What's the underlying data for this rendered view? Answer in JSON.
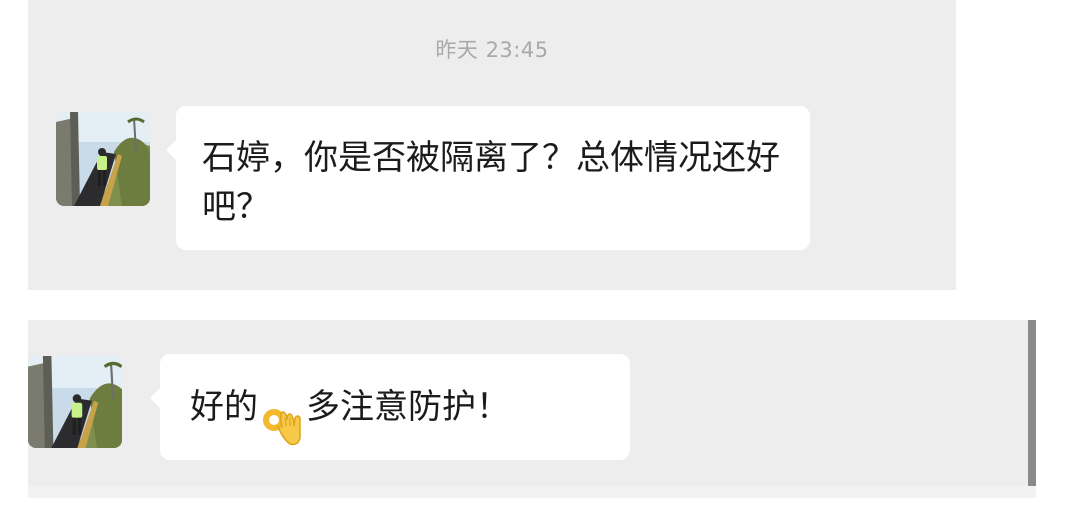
{
  "chat": {
    "timestamp": "昨天 23:45",
    "messages": [
      {
        "sender": "contact",
        "avatar_icon": "avatar-photo-icon",
        "text": "石婷，你是否被隔离了？总体情况还好吧？"
      },
      {
        "sender": "contact",
        "avatar_icon": "avatar-photo-icon",
        "text_before": "好的",
        "emoji_icon": "ok-hand-icon",
        "text_after": "多注意防护！"
      }
    ]
  },
  "colors": {
    "panel_background": "#ededed",
    "bubble_background": "#ffffff",
    "timestamp_text": "#a9a9a9",
    "message_text": "#1b1b1b"
  }
}
